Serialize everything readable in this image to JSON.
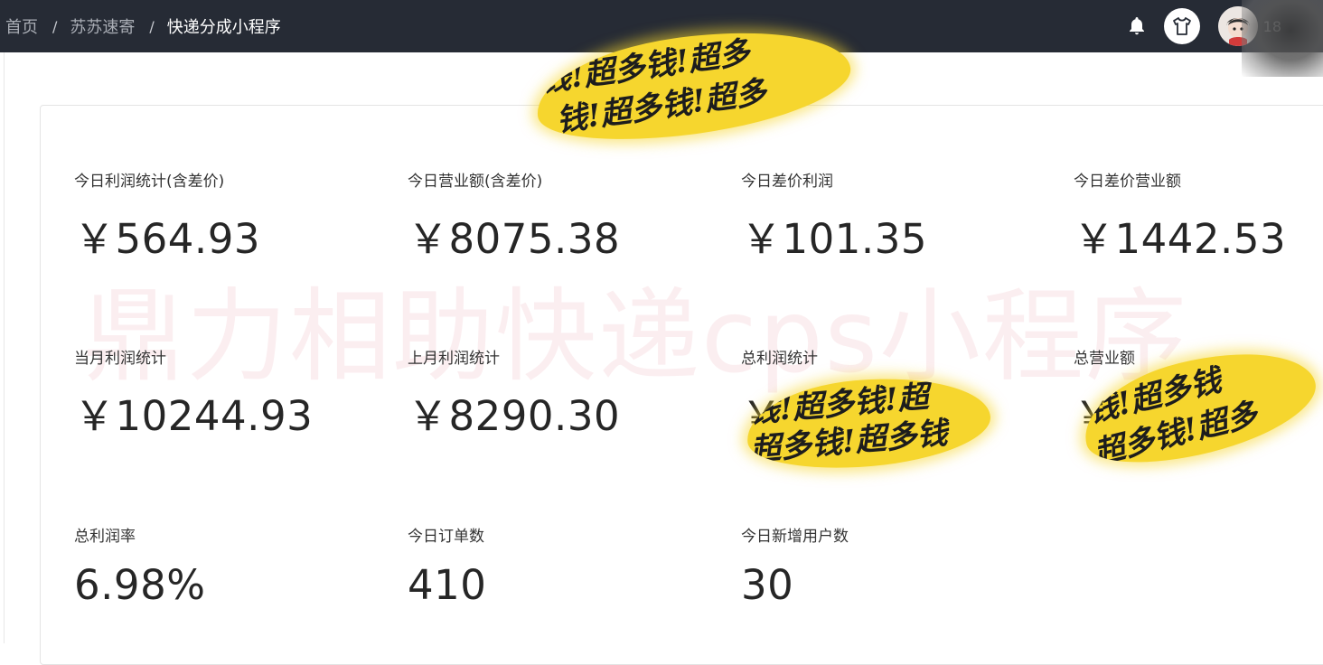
{
  "header": {
    "breadcrumb": [
      "首页",
      "苏苏速寄",
      "快递分成小程序"
    ],
    "separator": "/",
    "username": "18"
  },
  "watermark": "鼎力相助快递cps小程序",
  "stats": [
    {
      "label": "今日利润统计(含差价)",
      "value": "￥564.93"
    },
    {
      "label": "今日营业额(含差价)",
      "value": "￥8075.38"
    },
    {
      "label": "今日差价利润",
      "value": "￥101.35"
    },
    {
      "label": "今日差价营业额",
      "value": "￥1442.53"
    },
    {
      "label": "当月利润统计",
      "value": "￥10244.93"
    },
    {
      "label": "上月利润统计",
      "value": "￥8290.30"
    },
    {
      "label": "总利润统计",
      "value": "￥"
    },
    {
      "label": "总营业额",
      "value": "￥"
    },
    {
      "label": "总利润率",
      "value": "6.98%"
    },
    {
      "label": "今日订单数",
      "value": "410"
    },
    {
      "label": "今日新增用户数",
      "value": "30"
    }
  ],
  "stickers": [
    {
      "line1": "钱!超多钱!超多",
      "line2": "钱!超多钱!超多"
    },
    {
      "line1": "钱!超多钱!超",
      "line2": "超多钱!超多钱"
    },
    {
      "line1": "钱!超多钱",
      "line2": "超多钱!超多"
    }
  ],
  "colors": {
    "header_bg": "#262b35",
    "sticker": "#f6d62e",
    "watermark": "#e896a0"
  }
}
